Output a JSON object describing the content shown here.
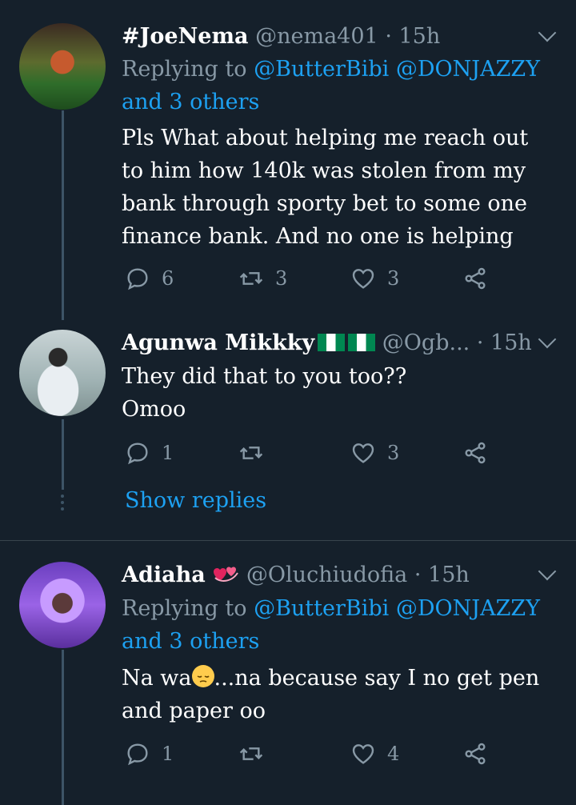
{
  "tweets": [
    {
      "name": "#JoeNema",
      "handle": "@nema401",
      "dot": "·",
      "time": "15h",
      "replying_prefix": "Replying to",
      "replying_users": "@ButterBibi @DONJAZZY",
      "replying_others": "and 3 others",
      "body_lines": [
        "Pls What about helping me reach out",
        "to him how 140k was stolen from my",
        "bank through sporty bet to some one",
        "finance bank. And no one is helping"
      ],
      "reply_count": "6",
      "retweet_count": "3",
      "like_count": "3"
    },
    {
      "name": "Agunwa Mikkky",
      "handle": "@Ogb...",
      "dot": "·",
      "time": "15h",
      "body_lines": [
        "They did that to you too??",
        "Omoo"
      ],
      "reply_count": "1",
      "retweet_count": "",
      "like_count": "3"
    },
    {
      "name": "Adiaha",
      "handle": "@Oluchiudofia",
      "dot": "·",
      "time": "15h",
      "replying_prefix": "Replying to",
      "replying_users": "@ButterBibi @DONJAZZY",
      "replying_others": "and 3 others",
      "body_line1_a": "Na wa",
      "body_line1_b": "...na because say I no get pen",
      "body_line2": "and paper oo",
      "reply_count": "1",
      "retweet_count": "",
      "like_count": "4"
    }
  ],
  "show_replies": "Show replies",
  "icons": {
    "reply": "reply-icon",
    "retweet": "retweet-icon",
    "like": "heart-icon",
    "share": "share-icon",
    "more": "chevron-down-icon"
  },
  "colors": {
    "background": "#15202b",
    "accent": "#1da1f2",
    "muted": "#8899a6"
  }
}
